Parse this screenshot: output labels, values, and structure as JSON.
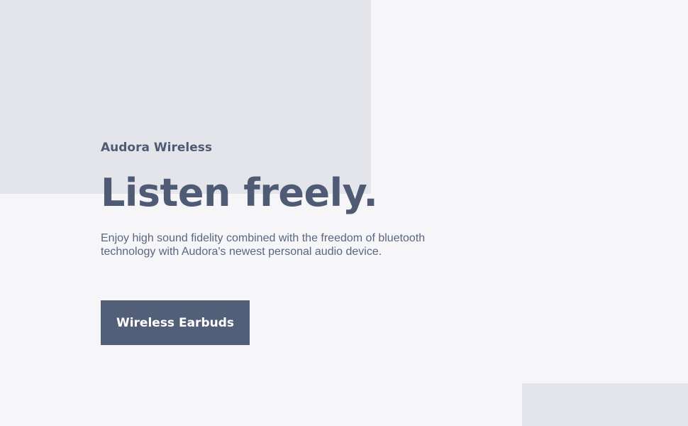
{
  "hero": {
    "brand": "Audora Wireless",
    "headline": "Listen freely.",
    "description": "Enjoy high sound fidelity combined with the freedom of bluetooth technology with Audora's newest personal audio device.",
    "cta_label": "Wireless Earbuds"
  },
  "colors": {
    "background": "#f6f6f9",
    "accent_block": "#e4e5ea",
    "text": "#4f5b74",
    "button": "#535f78",
    "button_text": "#ffffff"
  }
}
